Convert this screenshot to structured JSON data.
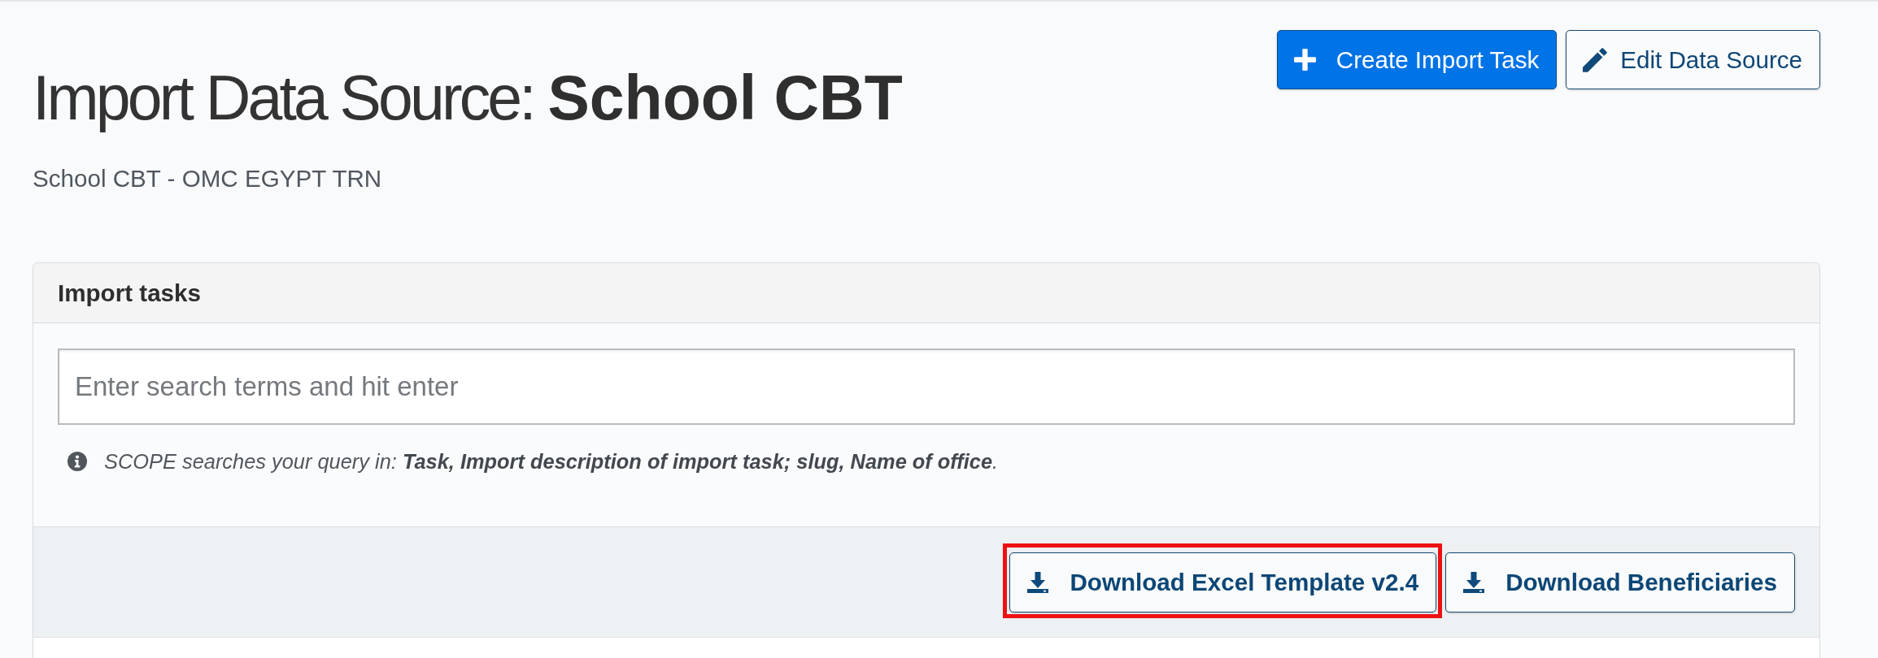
{
  "header": {
    "title": "Import Data Source: **School CBT**",
    "subtitle": "School CBT - OMC EGYPT TRN"
  },
  "actions": [
    {
      "label": "Create Import Task",
      "kind": "primary"
    },
    {
      "label": "Edit Data Source",
      "kind": "secondary"
    }
  ],
  "panel": {
    "title": "Import tasks",
    "search": {
      "placeholder": "Enter search terms and hit enter"
    },
    "scope_note": "SCOPE searches your query in: **Task, Import description of import task; slug, Name of office**.",
    "downloads": [
      {
        "label": "Download Excel Template v2.4",
        "highlighted": true
      },
      {
        "label": "Download Beneficiaries",
        "highlighted": false
      }
    ]
  }
}
